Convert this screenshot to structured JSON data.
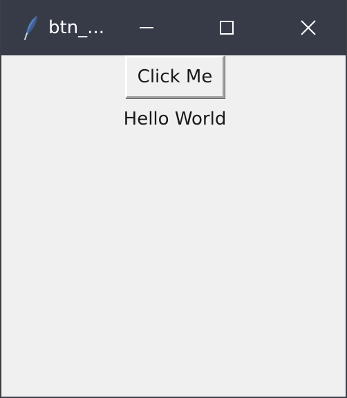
{
  "window": {
    "title": "btn_...",
    "icon": "feather-icon",
    "controls": {
      "minimize_icon": "minimize-icon",
      "maximize_icon": "maximize-icon",
      "close_icon": "close-icon"
    },
    "titlebar_color": "#363b47",
    "background_color": "#f0f0f0"
  },
  "content": {
    "button_label": "Click Me",
    "label_text": "Hello World"
  }
}
